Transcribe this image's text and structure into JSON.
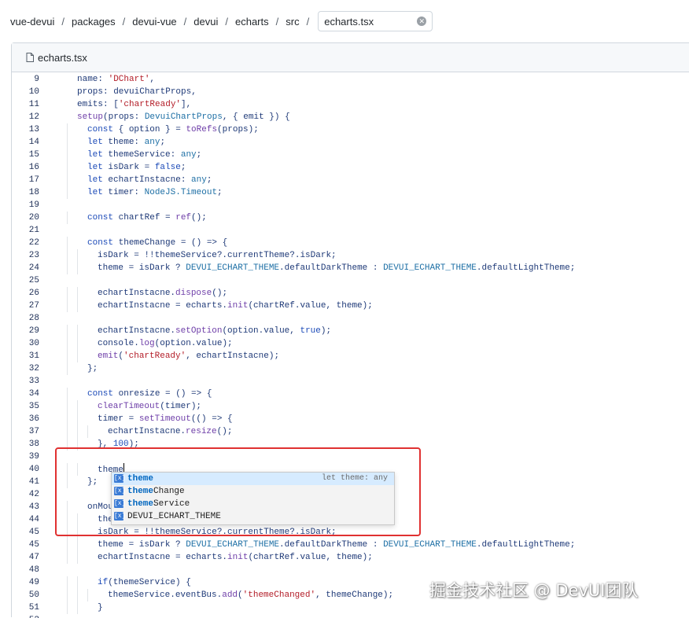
{
  "breadcrumb": {
    "items": [
      "vue-devui",
      "packages",
      "devui-vue",
      "devui",
      "echarts",
      "src"
    ],
    "separator": "/",
    "filename_input_value": "echarts.tsx"
  },
  "panel": {
    "filename": "echarts.tsx"
  },
  "code_lines": [
    {
      "n": "9",
      "indent": 0,
      "segs": [
        [
          "name: ",
          ""
        ],
        [
          "'DChart'",
          "str"
        ],
        [
          ",",
          ""
        ]
      ]
    },
    {
      "n": "10",
      "indent": 0,
      "segs": [
        [
          "props: devuiChartProps,",
          ""
        ]
      ]
    },
    {
      "n": "11",
      "indent": 0,
      "segs": [
        [
          "emits: [",
          ""
        ],
        [
          "'chartReady'",
          "str"
        ],
        [
          "],",
          ""
        ]
      ]
    },
    {
      "n": "12",
      "indent": 0,
      "segs": [
        [
          "setup",
          "fn"
        ],
        [
          "(props: ",
          ""
        ],
        [
          "DevuiChartProps",
          "ty"
        ],
        [
          ", { emit }) {",
          ""
        ]
      ]
    },
    {
      "n": "13",
      "indent": 1,
      "segs": [
        [
          "const",
          "kw"
        ],
        [
          " { option } = ",
          ""
        ],
        [
          "toRefs",
          "fn"
        ],
        [
          "(props);",
          ""
        ]
      ]
    },
    {
      "n": "14",
      "indent": 1,
      "segs": [
        [
          "let",
          "kw"
        ],
        [
          " theme: ",
          ""
        ],
        [
          "any",
          "ty"
        ],
        [
          ";",
          ""
        ]
      ]
    },
    {
      "n": "15",
      "indent": 1,
      "segs": [
        [
          "let",
          "kw"
        ],
        [
          " themeService: ",
          ""
        ],
        [
          "any",
          "ty"
        ],
        [
          ";",
          ""
        ]
      ]
    },
    {
      "n": "16",
      "indent": 1,
      "segs": [
        [
          "let",
          "kw"
        ],
        [
          " isDark = ",
          ""
        ],
        [
          "false",
          "kw"
        ],
        [
          ";",
          ""
        ]
      ]
    },
    {
      "n": "17",
      "indent": 1,
      "segs": [
        [
          "let",
          "kw"
        ],
        [
          " echartInstacne: ",
          ""
        ],
        [
          "any",
          "ty"
        ],
        [
          ";",
          ""
        ]
      ]
    },
    {
      "n": "18",
      "indent": 1,
      "segs": [
        [
          "let",
          "kw"
        ],
        [
          " timer: ",
          ""
        ],
        [
          "NodeJS.Timeout",
          "ty"
        ],
        [
          ";",
          ""
        ]
      ]
    },
    {
      "n": "19",
      "indent": 0,
      "segs": []
    },
    {
      "n": "20",
      "indent": 1,
      "segs": [
        [
          "const",
          "kw"
        ],
        [
          " chartRef = ",
          ""
        ],
        [
          "ref",
          "fn"
        ],
        [
          "();",
          ""
        ]
      ]
    },
    {
      "n": "21",
      "indent": 0,
      "segs": []
    },
    {
      "n": "22",
      "indent": 1,
      "segs": [
        [
          "const",
          "kw"
        ],
        [
          " themeChange = () => {",
          ""
        ]
      ]
    },
    {
      "n": "23",
      "indent": 2,
      "segs": [
        [
          "isDark = !!themeService?.currentTheme?.isDark;",
          ""
        ]
      ]
    },
    {
      "n": "24",
      "indent": 2,
      "segs": [
        [
          "theme = isDark ? ",
          ""
        ],
        [
          "DEVUI_ECHART_THEME",
          "ty"
        ],
        [
          ".defaultDarkTheme : ",
          ""
        ],
        [
          "DEVUI_ECHART_THEME",
          "ty"
        ],
        [
          ".defaultLightTheme;",
          ""
        ]
      ]
    },
    {
      "n": "25",
      "indent": 0,
      "segs": []
    },
    {
      "n": "26",
      "indent": 2,
      "segs": [
        [
          "echartInstacne.",
          ""
        ],
        [
          "dispose",
          "fn"
        ],
        [
          "();",
          ""
        ]
      ]
    },
    {
      "n": "27",
      "indent": 2,
      "segs": [
        [
          "echartInstacne = echarts.",
          ""
        ],
        [
          "init",
          "fn"
        ],
        [
          "(chartRef.value, theme);",
          ""
        ]
      ]
    },
    {
      "n": "28",
      "indent": 0,
      "segs": []
    },
    {
      "n": "29",
      "indent": 2,
      "segs": [
        [
          "echartInstacne.",
          ""
        ],
        [
          "setOption",
          "fn"
        ],
        [
          "(option.value, ",
          ""
        ],
        [
          "true",
          "kw"
        ],
        [
          ");",
          ""
        ]
      ]
    },
    {
      "n": "30",
      "indent": 2,
      "segs": [
        [
          "console.",
          ""
        ],
        [
          "log",
          "fn"
        ],
        [
          "(option.value);",
          ""
        ]
      ]
    },
    {
      "n": "31",
      "indent": 2,
      "segs": [
        [
          "emit",
          "fn"
        ],
        [
          "(",
          ""
        ],
        [
          "'chartReady'",
          "str"
        ],
        [
          ", echartInstacne);",
          ""
        ]
      ]
    },
    {
      "n": "32",
      "indent": 1,
      "segs": [
        [
          "};",
          ""
        ]
      ]
    },
    {
      "n": "33",
      "indent": 0,
      "segs": []
    },
    {
      "n": "34",
      "indent": 1,
      "segs": [
        [
          "const",
          "kw"
        ],
        [
          " onresize = () => {",
          ""
        ]
      ]
    },
    {
      "n": "35",
      "indent": 2,
      "segs": [
        [
          "clearTimeout",
          "fn"
        ],
        [
          "(timer);",
          ""
        ]
      ]
    },
    {
      "n": "36",
      "indent": 2,
      "segs": [
        [
          "timer = ",
          ""
        ],
        [
          "setTimeout",
          "fn"
        ],
        [
          "(() => {",
          ""
        ]
      ]
    },
    {
      "n": "37",
      "indent": 3,
      "segs": [
        [
          "echartInstacne.",
          ""
        ],
        [
          "resize",
          "fn"
        ],
        [
          "();",
          ""
        ]
      ]
    },
    {
      "n": "38",
      "indent": 2,
      "segs": [
        [
          "}, ",
          ""
        ],
        [
          "100",
          "kw"
        ],
        [
          ");",
          ""
        ]
      ]
    },
    {
      "n": "39",
      "indent": 0,
      "segs": []
    },
    {
      "n": "40",
      "indent": 2,
      "segs": [
        [
          "theme",
          ""
        ]
      ],
      "cursor": true
    },
    {
      "n": "41",
      "indent": 1,
      "segs": [
        [
          "};",
          ""
        ]
      ]
    },
    {
      "n": "42",
      "indent": 0,
      "segs": []
    },
    {
      "n": "43",
      "indent": 1,
      "segs": [
        [
          "onMount",
          ""
        ]
      ]
    },
    {
      "n": "44",
      "indent": 2,
      "segs": [
        [
          "theme",
          ""
        ]
      ]
    },
    {
      "n": "45",
      "indent": 2,
      "segs": [
        [
          "isDark = !!themeService?.currentTheme?.isDark;",
          ""
        ]
      ]
    },
    {
      "n": "45",
      "indent": 2,
      "segs": [
        [
          "theme = isDark ? ",
          ""
        ],
        [
          "DEVUI_ECHART_THEME",
          "ty"
        ],
        [
          ".defaultDarkTheme : ",
          ""
        ],
        [
          "DEVUI_ECHART_THEME",
          "ty"
        ],
        [
          ".defaultLightTheme;",
          ""
        ]
      ]
    },
    {
      "n": "47",
      "indent": 2,
      "segs": [
        [
          "echartInstacne = echarts.",
          ""
        ],
        [
          "init",
          "fn"
        ],
        [
          "(chartRef.value, theme);",
          ""
        ]
      ]
    },
    {
      "n": "48",
      "indent": 0,
      "segs": []
    },
    {
      "n": "49",
      "indent": 2,
      "segs": [
        [
          "if",
          "kw"
        ],
        [
          "(themeService) {",
          ""
        ]
      ]
    },
    {
      "n": "50",
      "indent": 3,
      "segs": [
        [
          "themeService.eventBus.",
          ""
        ],
        [
          "add",
          "fn"
        ],
        [
          "(",
          ""
        ],
        [
          "'themeChanged'",
          "str"
        ],
        [
          ", themeChange);",
          ""
        ]
      ]
    },
    {
      "n": "51",
      "indent": 2,
      "segs": [
        [
          "}",
          ""
        ]
      ]
    },
    {
      "n": "52",
      "indent": 0,
      "segs": []
    }
  ],
  "suggestions": [
    {
      "match": "theme",
      "rest": "",
      "detail": "let theme: any",
      "selected": true
    },
    {
      "match": "theme",
      "rest": "Change",
      "detail": "",
      "selected": false
    },
    {
      "match": "theme",
      "rest": "Service",
      "detail": "",
      "selected": false
    },
    {
      "match": "",
      "rest": "DEVUI_ECHART_THEME",
      "detail": "",
      "selected": false
    }
  ],
  "suggestion_icon_text": "[x]",
  "watermark": "掘金技术社区 @ DevUI团队",
  "colors": {
    "highlight_box": "#e03131",
    "suggest_selected": "#d6ebff",
    "keyword": "#1d4bb8",
    "string": "#b31d28"
  }
}
